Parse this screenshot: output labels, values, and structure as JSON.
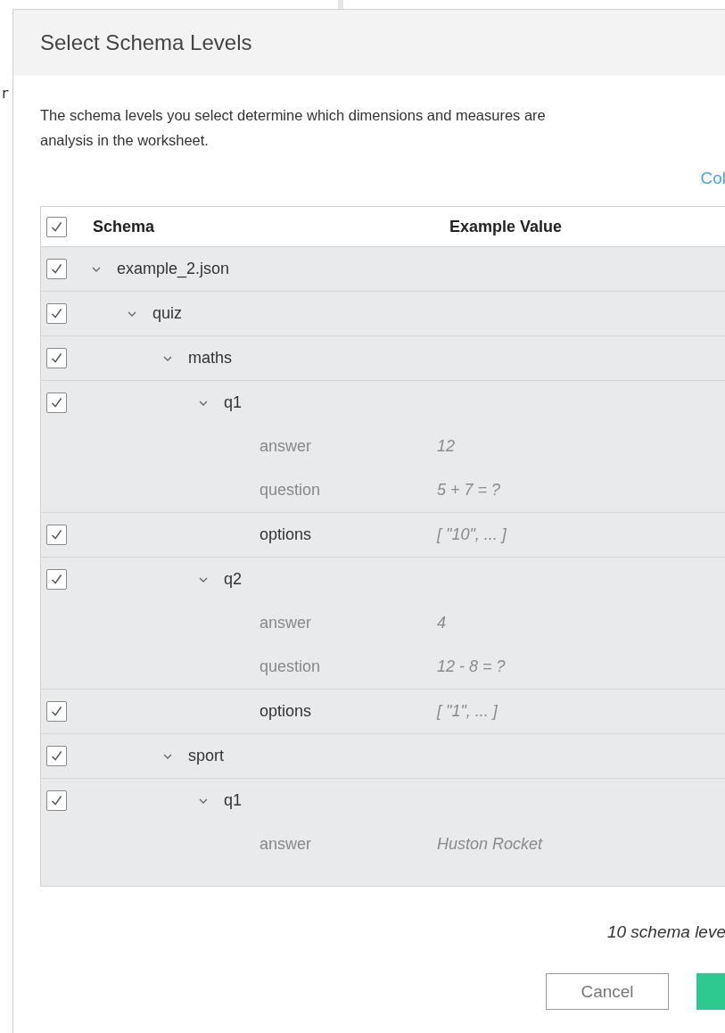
{
  "background_text": "r",
  "dialog": {
    "title": "Select Schema Levels",
    "description": "The schema levels you select determine which dimensions and measures are",
    "description_line_2": "analysis in the worksheet.",
    "link": "Col",
    "table": {
      "columns": [
        "Schema",
        "Example Value"
      ],
      "header_checked": true,
      "tree": [
        {
          "kind": "level",
          "label": "example_2.json",
          "checked": true,
          "expanded": true,
          "children": [
            {
              "kind": "level",
              "label": "quiz",
              "checked": true,
              "expanded": true,
              "children": [
                {
                  "kind": "level",
                  "label": "maths",
                  "checked": true,
                  "expanded": true,
                  "children": [
                    {
                      "kind": "level",
                      "label": "q1",
                      "checked": true,
                      "expanded": true,
                      "children": [
                        {
                          "kind": "field",
                          "label": "answer",
                          "value": "12"
                        },
                        {
                          "kind": "field",
                          "label": "question",
                          "value": "5 + 7 = ?"
                        },
                        {
                          "kind": "array",
                          "label": "options",
                          "value": "[ \"10\", ... ]",
                          "checked": true
                        }
                      ]
                    },
                    {
                      "kind": "level",
                      "label": "q2",
                      "checked": true,
                      "expanded": true,
                      "children": [
                        {
                          "kind": "field",
                          "label": "answer",
                          "value": "4"
                        },
                        {
                          "kind": "field",
                          "label": "question",
                          "value": "12 - 8 = ?"
                        },
                        {
                          "kind": "array",
                          "label": "options",
                          "value": "[ \"1\", ... ]",
                          "checked": true
                        }
                      ]
                    }
                  ]
                },
                {
                  "kind": "level",
                  "label": "sport",
                  "checked": true,
                  "expanded": true,
                  "children": [
                    {
                      "kind": "level",
                      "label": "q1",
                      "checked": true,
                      "expanded": true,
                      "children": [
                        {
                          "kind": "field",
                          "label": "answer",
                          "value": "Huston Rocket"
                        }
                      ]
                    }
                  ]
                }
              ]
            }
          ]
        }
      ]
    },
    "footer_note": "10 schema leve",
    "buttons": [
      "Cancel"
    ]
  }
}
